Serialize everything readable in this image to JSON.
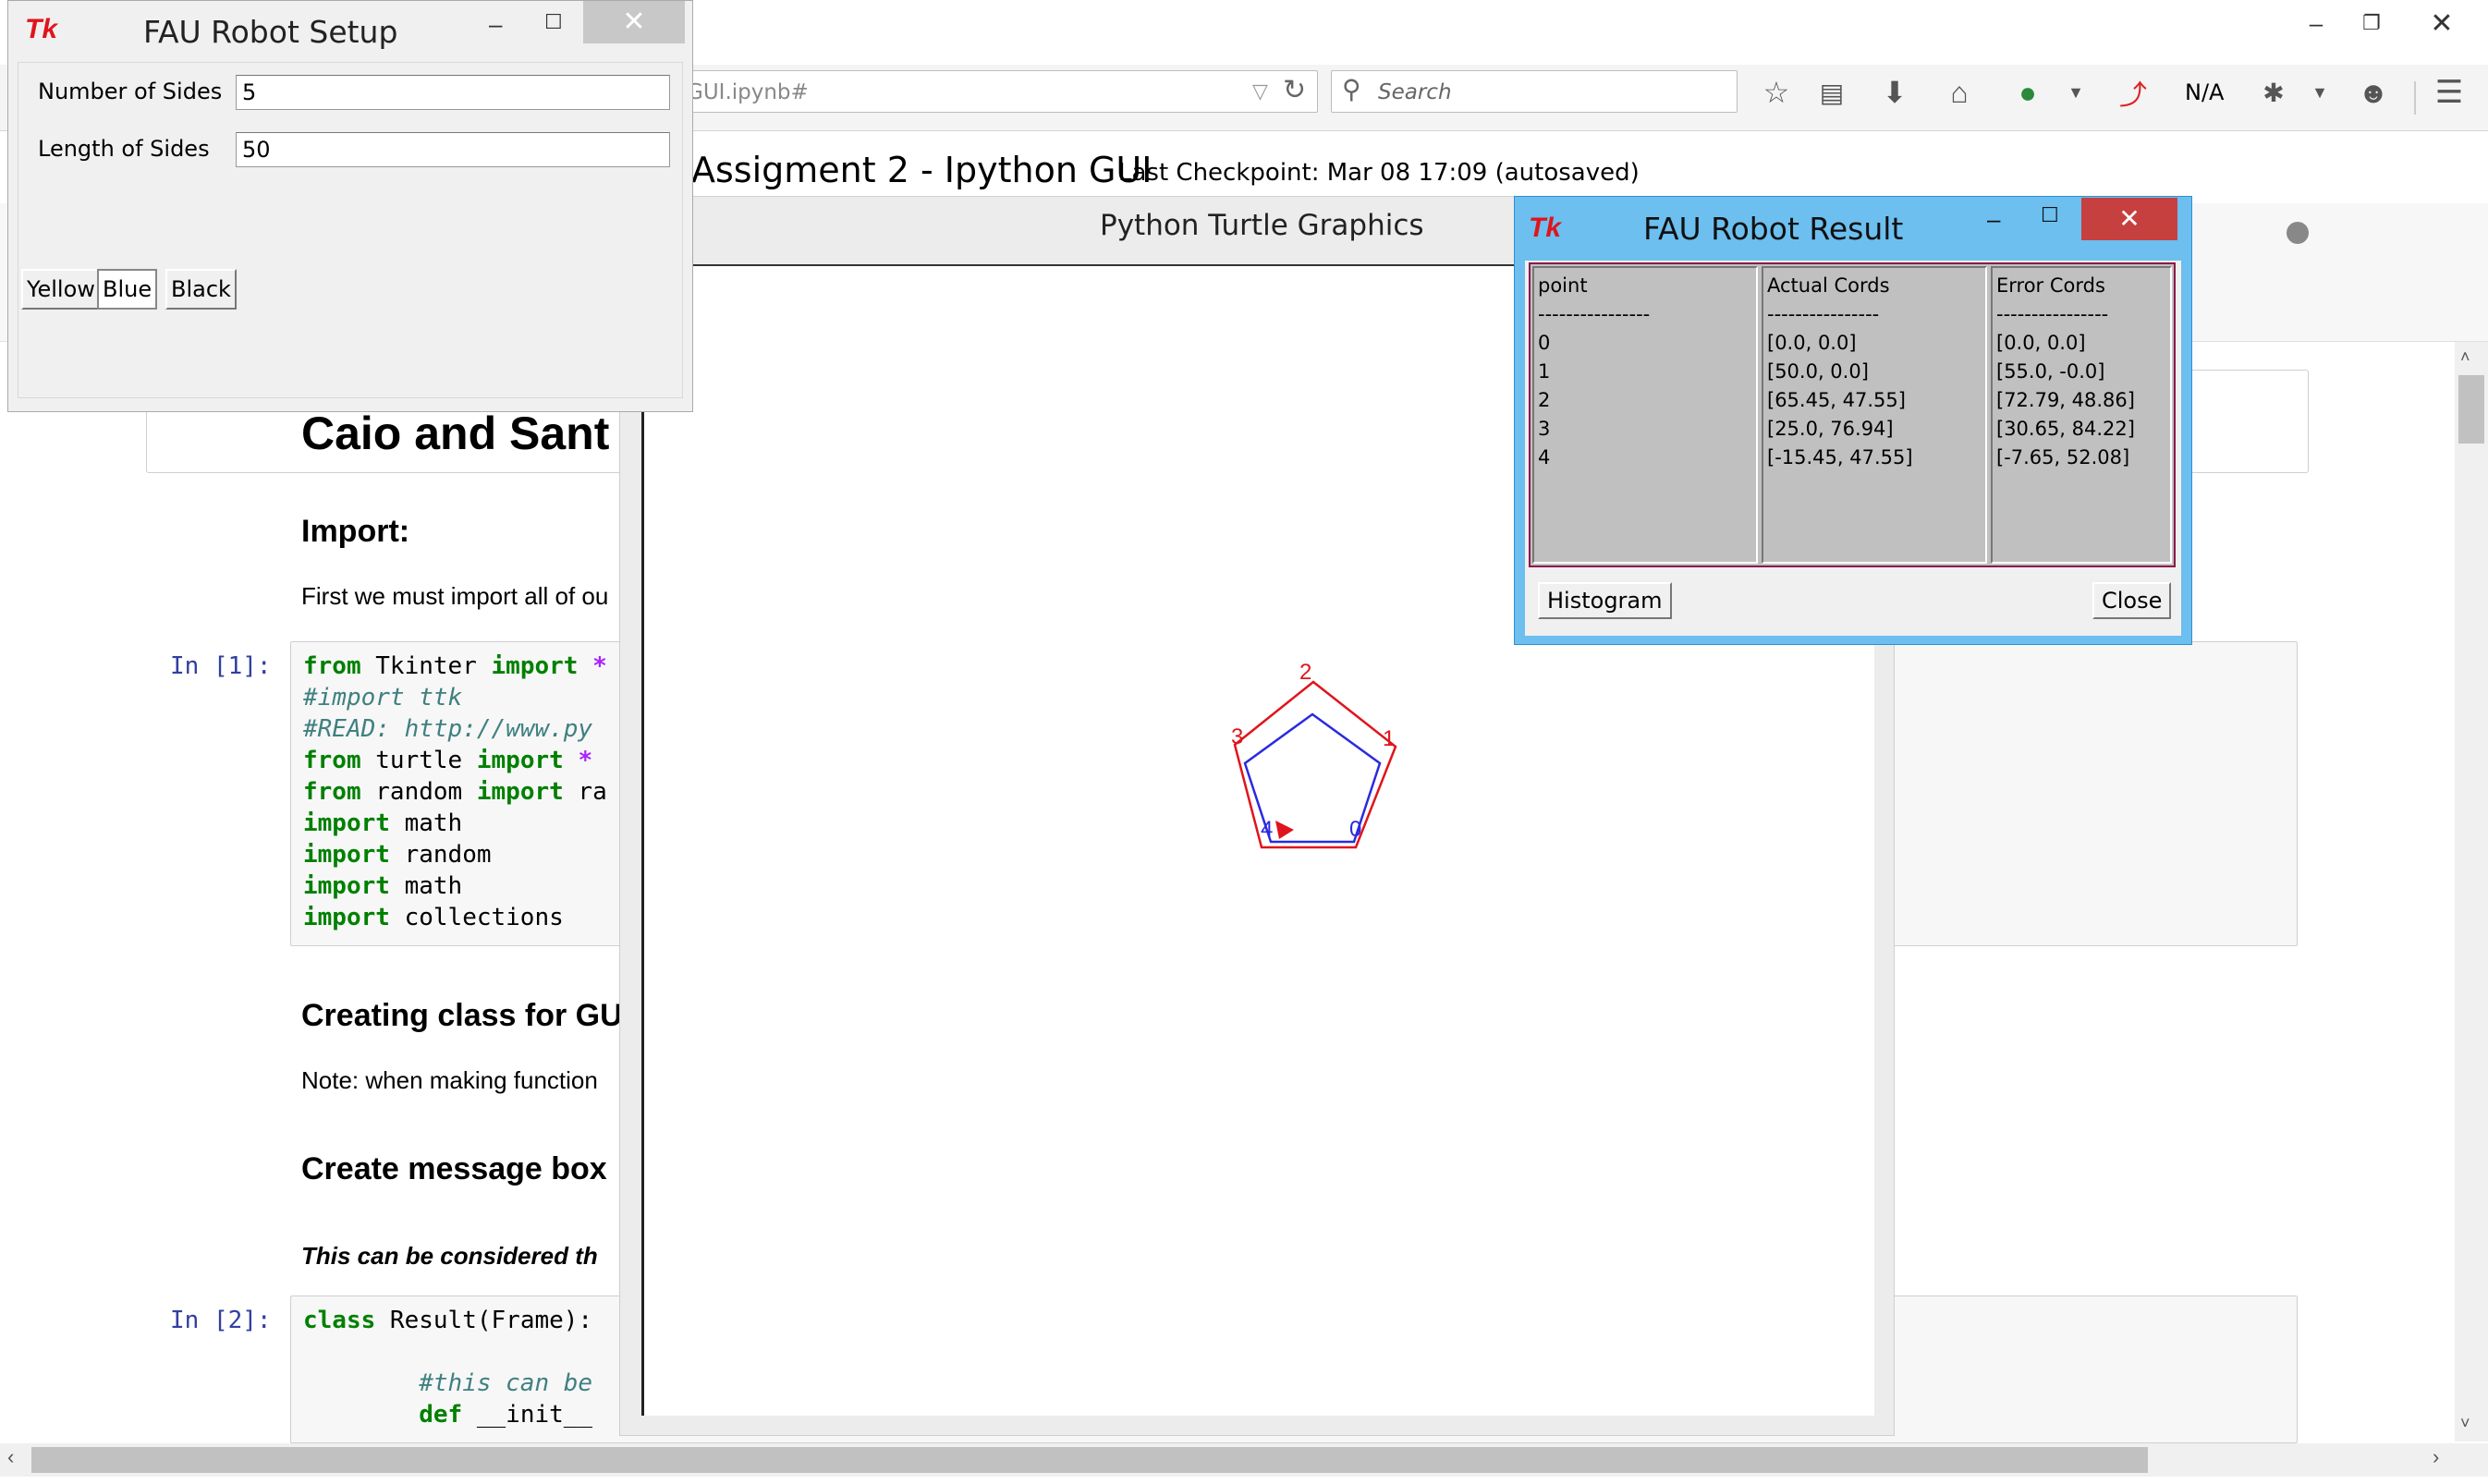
{
  "browser": {
    "url": "GUI.ipynb#",
    "search_placeholder": "Search",
    "na_label": "N/A"
  },
  "notebook": {
    "title": "Assigment 2 - Ipython GUI",
    "checkpoint": "Last Checkpoint: Mar 08 17:09 (autosaved)",
    "heading": "Caio and Sant",
    "section_import": "Import:",
    "import_text": "First we must import all of ou",
    "prompt1": "In [1]:",
    "section_class": "Creating class for GU",
    "note_text": "Note: when making function",
    "section_msgbox": "Create message box",
    "italic_text": "This can be considered th",
    "prompt2": "In [2]:"
  },
  "setup_window": {
    "title": "FAU Robot Setup",
    "sides_label": "Number of Sides",
    "sides_value": "5",
    "length_label": "Length of Sides",
    "length_value": "50",
    "buttons": [
      "Yellow",
      "Blue",
      "Black"
    ]
  },
  "turtle_window": {
    "title": "Python Turtle Graphics",
    "point_labels": [
      "0",
      "1",
      "2",
      "3",
      "4"
    ]
  },
  "result_window": {
    "title": "FAU Robot Result",
    "columns": [
      {
        "header": "point",
        "separator": "----------------",
        "rows": [
          "0",
          "1",
          "2",
          "3",
          "4"
        ]
      },
      {
        "header": "Actual Cords",
        "separator": "----------------",
        "rows": [
          "[0.0, 0.0]",
          "[50.0, 0.0]",
          "[65.45, 47.55]",
          "[25.0, 76.94]",
          "[-15.45, 47.55]"
        ]
      },
      {
        "header": "Error Cords",
        "separator": "----------------",
        "rows": [
          "[0.0, 0.0]",
          "[55.0, -0.0]",
          "[72.79, 48.86]",
          "[30.65, 84.22]",
          "[-7.65, 52.08]"
        ]
      }
    ],
    "histogram_button": "Histogram",
    "close_button": "Close"
  },
  "colors": {
    "tk_red": "#e0141c",
    "result_titlebar": "#6cbfef",
    "close_red": "#c74040",
    "code_keyword": "#008000",
    "comment": "#408080",
    "prompt": "#303f9f"
  }
}
